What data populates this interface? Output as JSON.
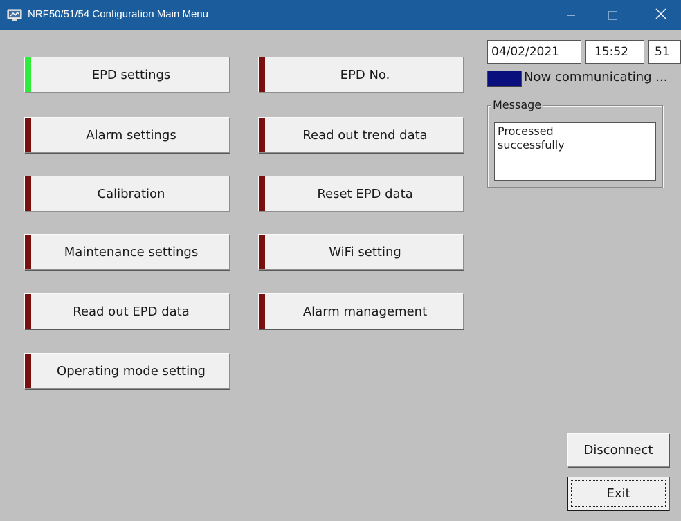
{
  "window": {
    "title": "NRF50/51/54 Configuration Main Menu",
    "icon": "app-window-icon",
    "controls": [
      "minimize-icon",
      "maximize-icon",
      "close-icon"
    ]
  },
  "menu": {
    "left": [
      {
        "label": "EPD settings",
        "indicator": "green"
      },
      {
        "label": "Alarm settings",
        "indicator": "darkred"
      },
      {
        "label": "Calibration",
        "indicator": "darkred"
      },
      {
        "label": "Maintenance settings",
        "indicator": "darkred"
      },
      {
        "label": "Read out EPD data",
        "indicator": "darkred"
      },
      {
        "label": "Operating mode setting",
        "indicator": "darkred"
      }
    ],
    "right": [
      {
        "label": "EPD No.",
        "indicator": "darkred"
      },
      {
        "label": "Read out trend data",
        "indicator": "darkred"
      },
      {
        "label": "Reset EPD data",
        "indicator": "darkred"
      },
      {
        "label": "WiFi setting",
        "indicator": "darkred"
      },
      {
        "label": "Alarm management",
        "indicator": "darkred"
      }
    ]
  },
  "info": {
    "date": "04/02/2021",
    "time": "15:52",
    "seconds": "51",
    "status_text": "Now communicating ...",
    "status_color": "#0a0f7e"
  },
  "message": {
    "legend": "Message",
    "text": "Processed\nsuccessfully"
  },
  "actions": {
    "disconnect": "Disconnect",
    "exit": "Exit"
  },
  "colors": {
    "titlebar": "#1b5d9c",
    "background": "#c0c0c0",
    "indicator_green": "#2fec3a",
    "indicator_darkred": "#7a0f0f"
  }
}
